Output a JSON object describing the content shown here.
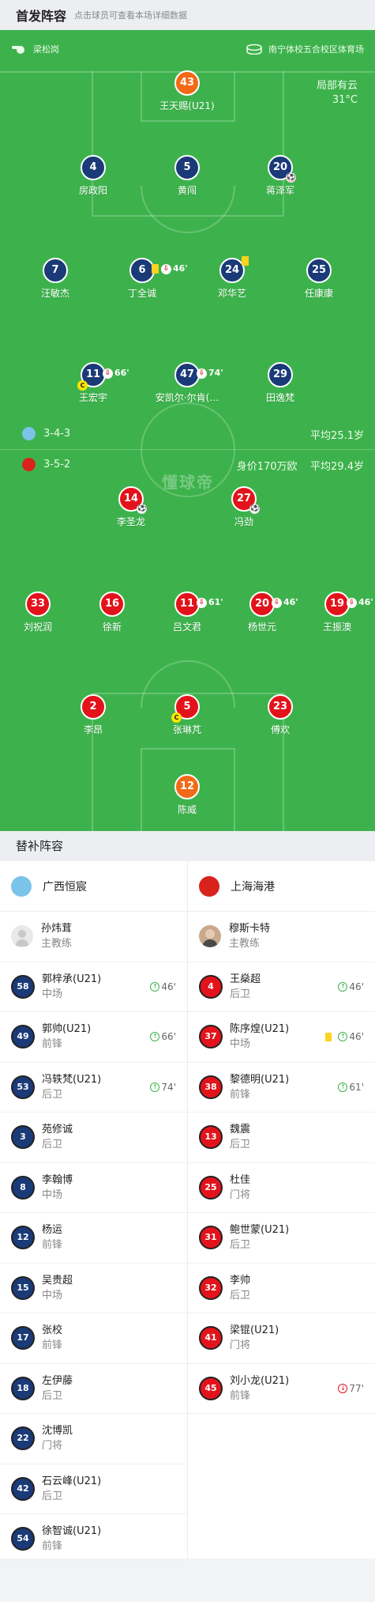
{
  "header": {
    "title": "首发阵容",
    "subtitle": "点击球员可查看本场详细数据"
  },
  "pitch": {
    "referee": "梁松岗",
    "venue": "南宁体校五合校区体育场",
    "weather": "局部有云",
    "temperature": "31°C",
    "watermark": "懂球帝",
    "home_formation": "3-4-3",
    "home_avg_age": "平均25.1岁",
    "away_formation": "3-5-2",
    "away_value": "身价170万欧",
    "away_avg_age": "平均29.4岁",
    "home_players": [
      {
        "num": "43",
        "name": "王天赐(U21)",
        "gk": true
      },
      {
        "num": "4",
        "name": "房政阳"
      },
      {
        "num": "5",
        "name": "黄闯"
      },
      {
        "num": "20",
        "name": "蒋泽军"
      },
      {
        "num": "7",
        "name": "汪敏杰"
      },
      {
        "num": "6",
        "name": "丁全诚",
        "sub": "46'"
      },
      {
        "num": "24",
        "name": "邓华艺"
      },
      {
        "num": "25",
        "name": "任康康"
      },
      {
        "num": "11",
        "name": "王宏宇",
        "sub": "66'"
      },
      {
        "num": "47",
        "name": "安凯尔·尔肯(…",
        "sub": "74'"
      },
      {
        "num": "29",
        "name": "田逸梵"
      }
    ],
    "away_players": [
      {
        "num": "14",
        "name": "李圣龙"
      },
      {
        "num": "27",
        "name": "冯劲"
      },
      {
        "num": "33",
        "name": "刘祝润"
      },
      {
        "num": "16",
        "name": "徐新"
      },
      {
        "num": "11",
        "name": "吕文君",
        "sub": "61'"
      },
      {
        "num": "20",
        "name": "杨世元",
        "sub": "46'"
      },
      {
        "num": "19",
        "name": "王振澳",
        "sub": "46'"
      },
      {
        "num": "2",
        "name": "李昂"
      },
      {
        "num": "5",
        "name": "张琳芃"
      },
      {
        "num": "23",
        "name": "傅欢"
      },
      {
        "num": "12",
        "name": "陈威",
        "gk": true
      }
    ],
    "captain_symbol": "C",
    "colors": {
      "pitch": "#3db24c",
      "home": "#1a3a78",
      "away": "#e3131b",
      "gk": "#f26a17"
    }
  },
  "subs": {
    "title": "替补阵容",
    "home": {
      "team": "广西恒宸",
      "coach": {
        "name": "孙炜茸",
        "role": "主教练"
      },
      "players": [
        {
          "num": "58",
          "name": "郭梓承(U21)",
          "pos": "中场",
          "ev": "46'"
        },
        {
          "num": "49",
          "name": "郭帅(U21)",
          "pos": "前锋",
          "ev": "66'"
        },
        {
          "num": "53",
          "name": "冯轶梵(U21)",
          "pos": "后卫",
          "ev": "74'"
        },
        {
          "num": "3",
          "name": "苑修诚",
          "pos": "后卫"
        },
        {
          "num": "8",
          "name": "李翰博",
          "pos": "中场"
        },
        {
          "num": "12",
          "name": "杨运",
          "pos": "前锋"
        },
        {
          "num": "15",
          "name": "吴贵超",
          "pos": "中场"
        },
        {
          "num": "17",
          "name": "张校",
          "pos": "前锋"
        },
        {
          "num": "18",
          "name": "左伊藤",
          "pos": "后卫"
        },
        {
          "num": "22",
          "name": "沈博凯",
          "pos": "门将"
        },
        {
          "num": "42",
          "name": "石云峰(U21)",
          "pos": "后卫"
        },
        {
          "num": "54",
          "name": "徐智诚(U21)",
          "pos": "前锋"
        }
      ]
    },
    "away": {
      "team": "上海海港",
      "coach": {
        "name": "穆斯卡特",
        "role": "主教练"
      },
      "players": [
        {
          "num": "4",
          "name": "王燊超",
          "pos": "后卫",
          "ev": "46'"
        },
        {
          "num": "37",
          "name": "陈序煌(U21)",
          "pos": "中场",
          "ev": "46'"
        },
        {
          "num": "38",
          "name": "黎德明(U21)",
          "pos": "前锋",
          "ev": "61'"
        },
        {
          "num": "13",
          "name": "魏震",
          "pos": "后卫"
        },
        {
          "num": "25",
          "name": "杜佳",
          "pos": "门将"
        },
        {
          "num": "31",
          "name": "鲍世蒙(U21)",
          "pos": "后卫"
        },
        {
          "num": "32",
          "name": "李帅",
          "pos": "后卫"
        },
        {
          "num": "41",
          "name": "梁锟(U21)",
          "pos": "门将"
        },
        {
          "num": "45",
          "name": "刘小龙(U21)",
          "pos": "前锋",
          "ev": "77'"
        }
      ]
    }
  }
}
